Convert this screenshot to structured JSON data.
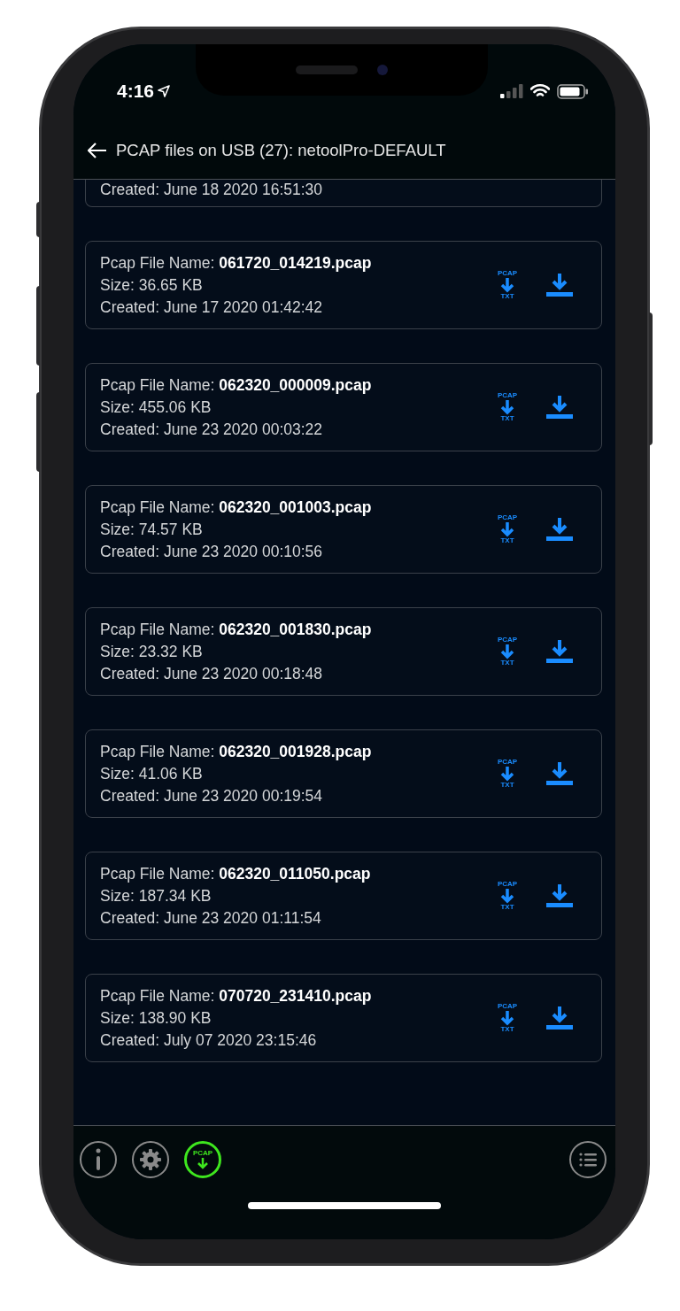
{
  "status_bar": {
    "time": "4:16"
  },
  "header": {
    "title": "PCAP files on USB (27): netoolPro-DEFAULT"
  },
  "files": [
    {
      "created": "Created: June 18 2020 16:51:30"
    },
    {
      "name": "Pcap File Name: **061720_014219.pcap**",
      "size": "Size: 36.65 KB",
      "created": "Created: June 17 2020 01:42:42",
      "convert": {
        "top": "PCAP",
        "bottom": "TXT"
      }
    },
    {
      "name": "Pcap File Name: **062320_000009.pcap**",
      "size": "Size: 455.06 KB",
      "created": "Created: June 23 2020 00:03:22",
      "convert": {
        "top": "PCAP",
        "bottom": "TXT"
      }
    },
    {
      "name": "Pcap File Name: **062320_001003.pcap**",
      "size": "Size: 74.57 KB",
      "created": "Created: June 23 2020 00:10:56",
      "convert": {
        "top": "PCAP",
        "bottom": "TXT"
      }
    },
    {
      "name": "Pcap File Name: **062320_001830.pcap**",
      "size": "Size: 23.32 KB",
      "created": "Created: June 23 2020 00:18:48",
      "convert": {
        "top": "PCAP",
        "bottom": "TXT"
      }
    },
    {
      "name": "Pcap File Name: **062320_001928.pcap**",
      "size": "Size: 41.06 KB",
      "created": "Created: June 23 2020 00:19:54",
      "convert": {
        "top": "PCAP",
        "bottom": "TXT"
      }
    },
    {
      "name": "Pcap File Name: **062320_011050.pcap**",
      "size": "Size: 187.34 KB",
      "created": "Created: June 23 2020 01:11:54",
      "convert": {
        "top": "PCAP",
        "bottom": "TXT"
      }
    },
    {
      "name": "Pcap File Name: **070720_231410.pcap**",
      "size": "Size: 138.90 KB",
      "created": "Created: July 07 2020 23:15:46",
      "convert": {
        "top": "PCAP",
        "bottom": "TXT"
      }
    }
  ],
  "toolbar": [
    {
      "kind": "info",
      "selected": false
    },
    {
      "kind": "settings",
      "selected": false
    },
    {
      "kind": "pcap",
      "label": "PCAP",
      "selected": true
    },
    {
      "kind": "list",
      "selected": false
    }
  ]
}
